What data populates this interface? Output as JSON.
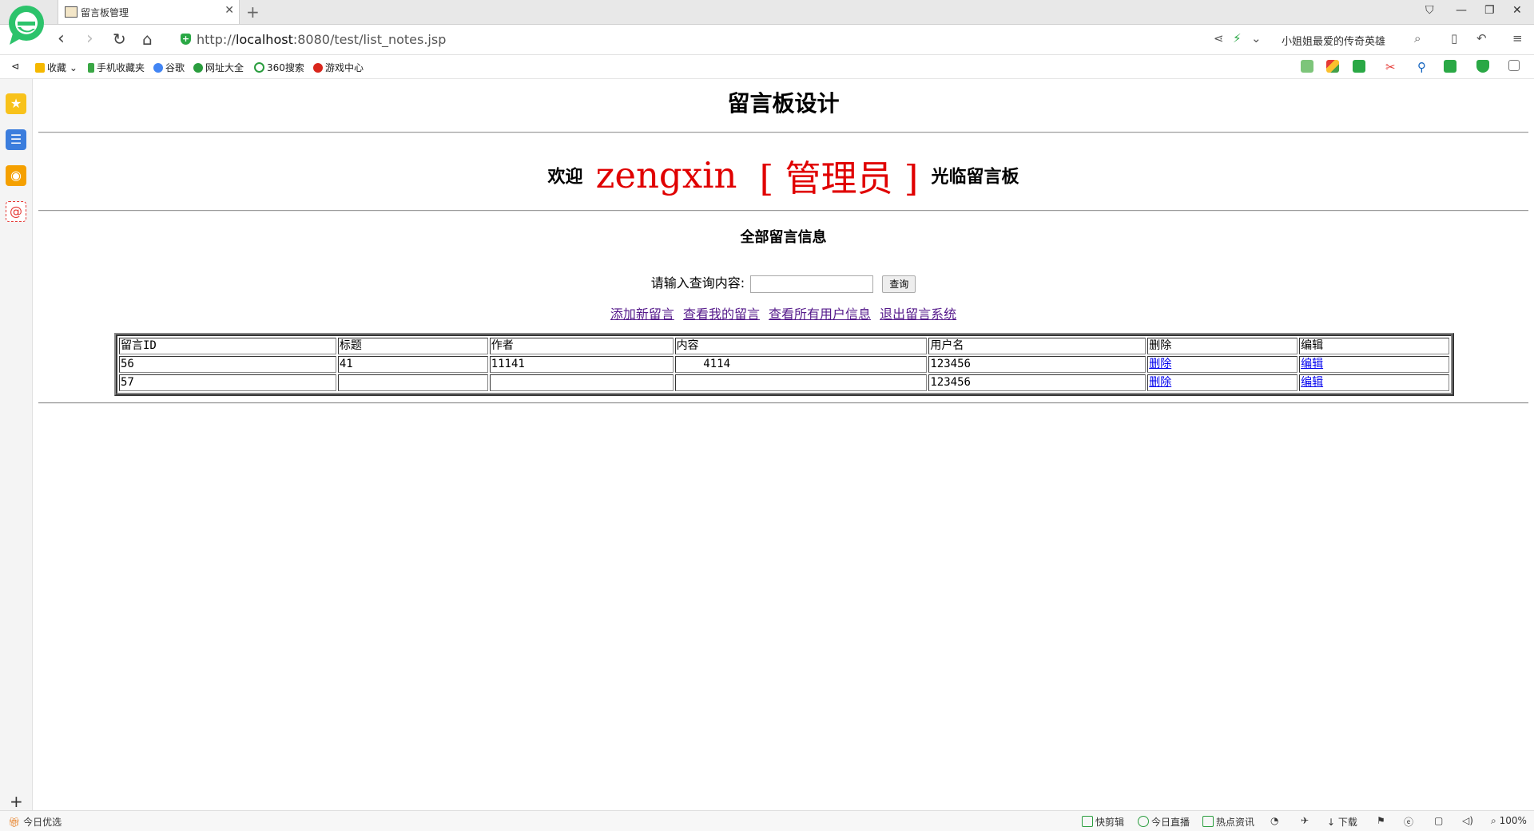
{
  "browser": {
    "tab_title": "留言板管理",
    "url_prefix": "http://",
    "url_host": "localhost",
    "url_rest": ":8080/test/list_notes.jsp",
    "hot_search": "小姐姐最爱的传奇英雄"
  },
  "bookmarks": [
    {
      "label": "收藏",
      "color": "#f5b800"
    },
    {
      "label": "手机收藏夹",
      "color": "#3aa745"
    },
    {
      "label": "谷歌",
      "color": "#4285f4"
    },
    {
      "label": "网址大全",
      "color": "#2a9d3e"
    },
    {
      "label": "360搜索",
      "color": "#2a9d3e"
    },
    {
      "label": "游戏中心",
      "color": "#d9261c"
    }
  ],
  "status": {
    "left": "今日优选",
    "items": [
      "快剪辑",
      "今日直播",
      "热点资讯",
      "下载"
    ],
    "zoom": "100%"
  },
  "page": {
    "title": "留言板设计",
    "welcome_prefix": "欢迎",
    "user": "zengxin",
    "role": "[ 管理员 ]",
    "welcome_suffix": "光临留言板",
    "section_title": "全部留言信息",
    "search_label": "请输入查询内容:",
    "search_value": "",
    "search_button": "查询",
    "links": [
      "添加新留言",
      "查看我的留言",
      "查看所有用户信息",
      "退出留言系统"
    ]
  },
  "table": {
    "headers": [
      "留言ID",
      "标题",
      "作者",
      "内容",
      "用户名",
      "删除",
      "编辑"
    ],
    "rows": [
      {
        "id": "56",
        "title": "41",
        "author": "11141",
        "content": "    4114",
        "username": "123456",
        "delete": "删除",
        "edit": "编辑"
      },
      {
        "id": "57",
        "title": "",
        "author": "",
        "content": "",
        "username": "123456",
        "delete": "删除",
        "edit": "编辑"
      }
    ]
  }
}
